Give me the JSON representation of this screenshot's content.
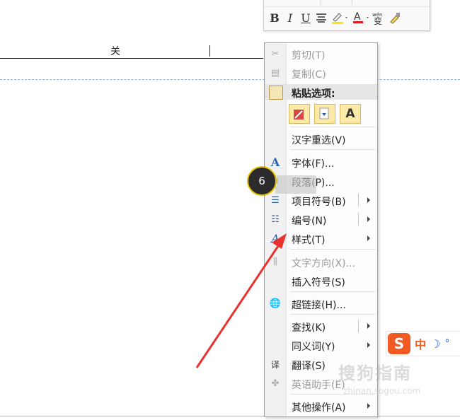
{
  "document": {
    "visible_text": "关"
  },
  "mini_toolbar": {
    "bold": "B",
    "italic": "I",
    "underline": "U",
    "font_color_glyph": "A",
    "phonetic_glyph": "wén 变"
  },
  "context_menu": {
    "items": [
      {
        "label": "剪切(T)",
        "icon": "scissors-icon",
        "disabled": true,
        "arrow": false
      },
      {
        "label": "复制(C)",
        "icon": "copy-icon",
        "disabled": true,
        "arrow": false
      },
      {
        "label": "粘贴选项:",
        "icon": "clipboard-icon",
        "header": true
      },
      {
        "label": "汉字重选(V)",
        "icon": "",
        "disabled": false,
        "arrow": false
      },
      {
        "label": "字体(F)...",
        "icon": "font-icon",
        "disabled": false,
        "arrow": false
      },
      {
        "label": "段落(P)...",
        "icon": "paragraph-icon",
        "disabled": false,
        "arrow": false
      },
      {
        "label": "项目符号(B)",
        "icon": "bullets-icon",
        "disabled": false,
        "arrow": true
      },
      {
        "label": "编号(N)",
        "icon": "numbering-icon",
        "disabled": false,
        "arrow": true
      },
      {
        "label": "样式(T)",
        "icon": "styles-icon",
        "disabled": false,
        "arrow": true
      },
      {
        "label": "文字方向(X)...",
        "icon": "text-direction-icon",
        "disabled": true,
        "arrow": false
      },
      {
        "label": "插入符号(S)",
        "icon": "",
        "disabled": false,
        "arrow": false
      },
      {
        "label": "超链接(H)...",
        "icon": "hyperlink-icon",
        "disabled": false,
        "arrow": false
      },
      {
        "label": "查找(K)",
        "icon": "",
        "disabled": false,
        "arrow": true
      },
      {
        "label": "同义词(Y)",
        "icon": "",
        "disabled": false,
        "arrow": true
      },
      {
        "label": "翻译(S)",
        "icon": "translate-icon",
        "disabled": false,
        "arrow": false
      },
      {
        "label": "英语助手(E)",
        "icon": "english-assistant-icon",
        "disabled": true,
        "arrow": false
      },
      {
        "label": "其他操作(A)",
        "icon": "",
        "disabled": false,
        "arrow": true
      }
    ],
    "paste_options": [
      "keep-format",
      "merge-format",
      "A"
    ]
  },
  "step_badge": "6",
  "ime": {
    "logo": "S",
    "mode": "中",
    "moon": "☽",
    "dot": "°"
  },
  "watermark": {
    "line1": "搜狗指南",
    "line2": "zhinan.sogou.com"
  },
  "colors": {
    "arrow": "#e8322f",
    "highlight_yellow": "#ffe600",
    "font_red": "#e01b1b"
  }
}
